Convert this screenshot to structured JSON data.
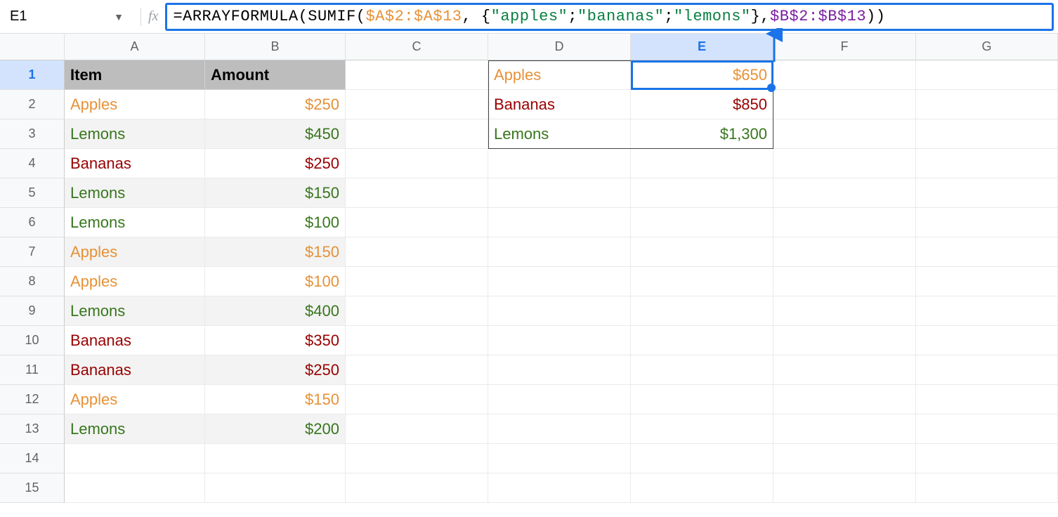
{
  "namebox": "E1",
  "formula": {
    "prefix": "=ARRAYFORMULA(SUMIF(",
    "range1": "$A$2:$A$13",
    "sep1": ", {",
    "lit1": "\"apples\"",
    "sep2": "; ",
    "lit2": "\"bananas\"",
    "sep3": "; ",
    "lit3": "\"lemons\"",
    "sep4": "}, ",
    "range2": "$B$2:$B$13",
    "suffix": "))"
  },
  "colHeaders": [
    "A",
    "B",
    "C",
    "D",
    "E",
    "F",
    "G"
  ],
  "rowHeaders": [
    "1",
    "2",
    "3",
    "4",
    "5",
    "6",
    "7",
    "8",
    "9",
    "10",
    "11",
    "12",
    "13",
    "14",
    "15"
  ],
  "headers": {
    "item": "Item",
    "amount": "Amount"
  },
  "table": [
    {
      "item": "Apples",
      "amount": "$250",
      "cls": "apples",
      "band": "band-even"
    },
    {
      "item": "Lemons",
      "amount": "$450",
      "cls": "lemons",
      "band": "band-odd"
    },
    {
      "item": "Bananas",
      "amount": "$250",
      "cls": "bananas",
      "band": "band-even"
    },
    {
      "item": "Lemons",
      "amount": "$150",
      "cls": "lemons",
      "band": "band-odd"
    },
    {
      "item": "Lemons",
      "amount": "$100",
      "cls": "lemons",
      "band": "band-even"
    },
    {
      "item": "Apples",
      "amount": "$150",
      "cls": "apples",
      "band": "band-odd"
    },
    {
      "item": "Apples",
      "amount": "$100",
      "cls": "apples",
      "band": "band-even"
    },
    {
      "item": "Lemons",
      "amount": "$400",
      "cls": "lemons",
      "band": "band-odd"
    },
    {
      "item": "Bananas",
      "amount": "$350",
      "cls": "bananas",
      "band": "band-even"
    },
    {
      "item": "Bananas",
      "amount": "$250",
      "cls": "bananas",
      "band": "band-odd"
    },
    {
      "item": "Apples",
      "amount": "$150",
      "cls": "apples",
      "band": "band-even"
    },
    {
      "item": "Lemons",
      "amount": "$200",
      "cls": "lemons",
      "band": "band-odd"
    }
  ],
  "results": [
    {
      "label": "Apples",
      "value": "$650",
      "cls": "apples"
    },
    {
      "label": "Bananas",
      "value": "$850",
      "cls": "bananas"
    },
    {
      "label": "Lemons",
      "value": "$1,300",
      "cls": "lemons"
    }
  ]
}
